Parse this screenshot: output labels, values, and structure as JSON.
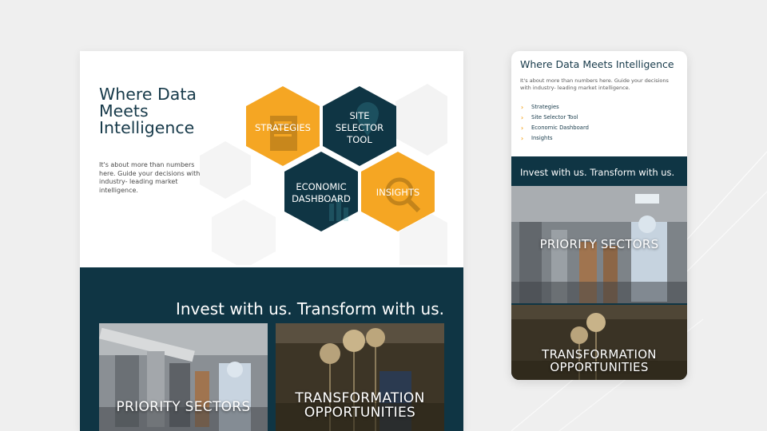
{
  "desktop": {
    "hero": {
      "title": "Where Data Meets Intelligence",
      "description": "It's about more than numbers here. Guide your decisions with industry- leading market intelligence."
    },
    "hexes": [
      {
        "line1": "STRATEGIES",
        "line2": "",
        "line3": "",
        "color": "#f5a623",
        "icon": "document-icon"
      },
      {
        "line1": "SITE",
        "line2": "SELECTOR",
        "line3": "TOOL",
        "color": "#0f3544",
        "icon": "map-pin-icon"
      },
      {
        "line1": "ECONOMIC",
        "line2": "DASHBOARD",
        "line3": "",
        "color": "#0f3544",
        "icon": "bar-chart-icon"
      },
      {
        "line1": "INSIGHTS",
        "line2": "",
        "line3": "",
        "color": "#f5a623",
        "icon": "magnifier-icon"
      }
    ],
    "tagline": "Invest with us. Transform with us.",
    "tiles": [
      {
        "line1": "PRIORITY SECTORS",
        "line2": ""
      },
      {
        "line1": "TRANSFORMATION",
        "line2": "OPPORTUNITIES"
      }
    ]
  },
  "mobile": {
    "title": "Where Data Meets Intelligence",
    "description": "It's about more than numbers here. Guide your decisions with industry- leading market intelligence.",
    "nav": [
      "Strategies",
      "Site Selector Tool",
      "Economic Dashboard",
      "Insights"
    ],
    "tagline": "Invest with us. Transform with us.",
    "tiles": [
      {
        "line1": "PRIORITY SECTORS",
        "line2": ""
      },
      {
        "line1": "TRANSFORMATION",
        "line2": "OPPORTUNITIES"
      }
    ]
  },
  "colors": {
    "navy": "#0f3544",
    "orange": "#f5a623",
    "background": "#efefef"
  }
}
